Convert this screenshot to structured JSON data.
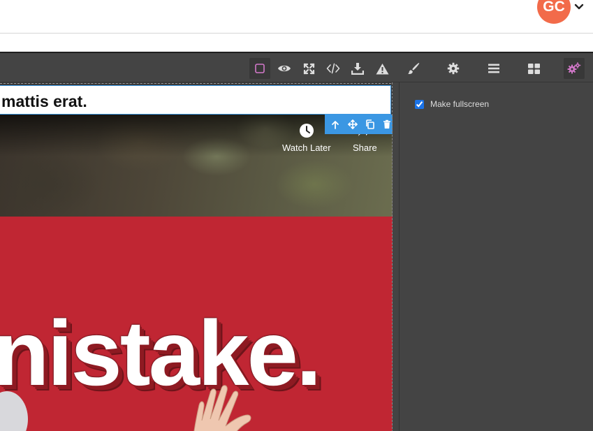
{
  "header": {
    "avatar_initials": "GC",
    "avatar_color": "#f26b4a"
  },
  "toolbar": {
    "buttons": [
      {
        "name": "sw-visibility",
        "icon": "square-outline-icon",
        "active": true
      },
      {
        "name": "preview",
        "icon": "eye-icon"
      },
      {
        "name": "fullscreen",
        "icon": "expand-arrows-icon"
      },
      {
        "name": "export-code",
        "icon": "code-icon"
      },
      {
        "name": "import",
        "icon": "download-icon"
      },
      {
        "name": "warning",
        "icon": "warning-triangle-icon"
      }
    ],
    "panels": [
      {
        "name": "style-manager",
        "icon": "paintbrush-icon"
      },
      {
        "name": "trait-manager",
        "icon": "gear-icon"
      },
      {
        "name": "layer-manager",
        "icon": "bars-icon"
      },
      {
        "name": "block-manager",
        "icon": "grid-icon"
      },
      {
        "name": "settings",
        "icon": "gears-icon",
        "active": true
      }
    ],
    "accent_color": "#d278c9"
  },
  "canvas": {
    "heading_text": "mattis erat.",
    "video_actions": [
      {
        "label": "Watch Later",
        "icon": "clock-icon"
      },
      {
        "label": "Share",
        "icon": "share-icon"
      }
    ],
    "component_toolbar": [
      "arrow-up-icon",
      "move-icon",
      "copy-icon",
      "trash-icon"
    ],
    "selection_color": "#3b97e3",
    "poster_text": "nistake.",
    "poster_color": "#c02633"
  },
  "panel": {
    "traits": [
      {
        "label": "Make fullscreen",
        "checked": true
      }
    ]
  }
}
